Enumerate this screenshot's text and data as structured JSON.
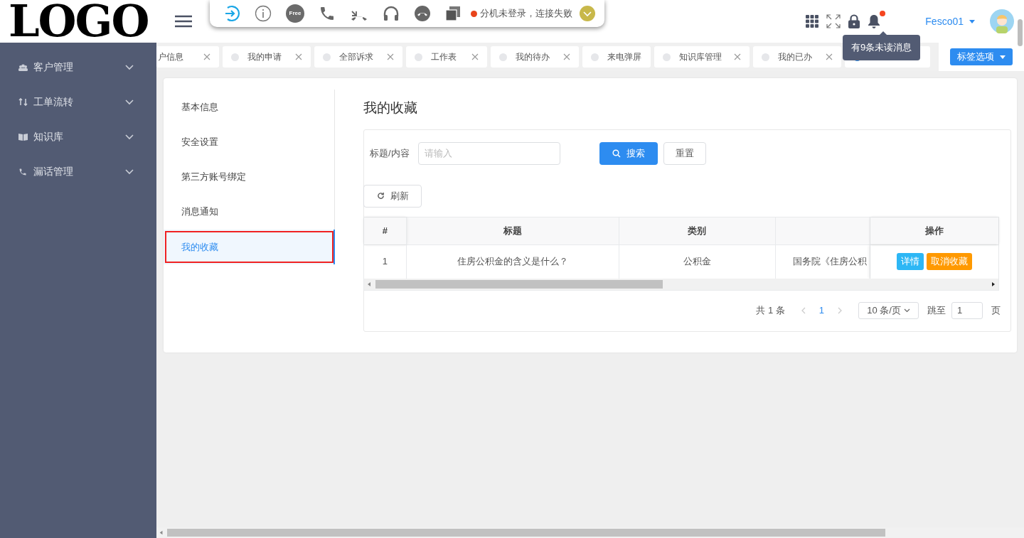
{
  "logo": "LOGO",
  "sidebar": {
    "items": [
      {
        "label": "客户管理",
        "expanded": false
      },
      {
        "label": "工单流转",
        "expanded": false
      },
      {
        "label": "知识库",
        "expanded": false
      },
      {
        "label": "漏话管理",
        "expanded": false
      }
    ]
  },
  "toolbar": {
    "tools": [
      {
        "kind": "login"
      },
      {
        "kind": "info"
      },
      {
        "kind": "free",
        "label": "Free"
      },
      {
        "kind": "call"
      },
      {
        "kind": "hangup"
      },
      {
        "kind": "headset"
      },
      {
        "kind": "end"
      },
      {
        "kind": "copy"
      }
    ],
    "status": "分机未登录，连接失败"
  },
  "header": {
    "user": "Fesco01",
    "notice_count_dot": true,
    "tooltip": "有9条未读消息"
  },
  "tabs": [
    {
      "label": "户信息",
      "selected": false
    },
    {
      "label": "我的申请",
      "selected": false
    },
    {
      "label": "全部诉求",
      "selected": false
    },
    {
      "label": "工作表",
      "selected": false
    },
    {
      "label": "我的待办",
      "selected": false
    },
    {
      "label": "来电弹屏",
      "selected": false
    },
    {
      "label": "知识库管理",
      "selected": false
    },
    {
      "label": "我的已办",
      "selected": false
    },
    {
      "selected": true
    }
  ],
  "tab_options": "标签选项",
  "menu": [
    {
      "label": "基本信息",
      "selected": false
    },
    {
      "label": "安全设置",
      "selected": false
    },
    {
      "label": "第三方账号绑定",
      "selected": false
    },
    {
      "label": "消息通知",
      "selected": false
    },
    {
      "label": "我的收藏",
      "selected": true
    }
  ],
  "page_title": "我的收藏",
  "filter": {
    "label": "标题/内容",
    "placeholder": "请输入",
    "search": "搜索",
    "reset": "重置",
    "refresh": "刷新"
  },
  "table": {
    "columns": [
      "#",
      "标题",
      "类别",
      "",
      "操作"
    ],
    "rows": [
      {
        "cells": [
          "1",
          "住房公积金的含义是什么？",
          "公积金",
          "国务院《住房公积"
        ],
        "actions": [
          "详情",
          "取消收藏"
        ]
      }
    ]
  },
  "pagination": {
    "total": "共 1 条",
    "pages": [
      {
        "label": "1",
        "selected": true
      }
    ],
    "page_size": "10 条/页",
    "goto": "跳至",
    "goto_value": "1",
    "page_unit": "页"
  }
}
